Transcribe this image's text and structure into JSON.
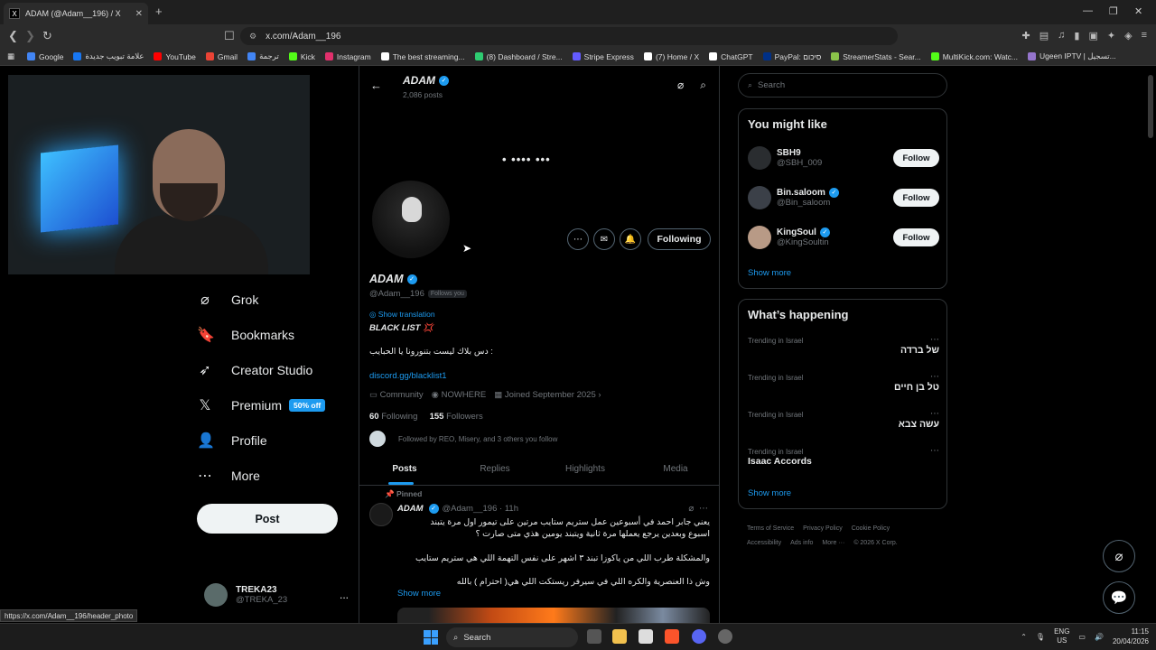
{
  "browser": {
    "tab_title": "ADAM (@Adam__196) / X",
    "new_tab": "+",
    "url": "x.com/Adam__196",
    "status_url": "https://x.com/Adam__196/header_photo",
    "bookmarks": [
      {
        "label": "Google",
        "color": "#4285f4"
      },
      {
        "label": "علامة تبويب جديدة",
        "color": "#1877f2"
      },
      {
        "label": "YouTube",
        "color": "#ff0000"
      },
      {
        "label": "Gmail",
        "color": "#ea4335"
      },
      {
        "label": "ترجمة",
        "color": "#4285f4"
      },
      {
        "label": "Kick",
        "color": "#53fc18"
      },
      {
        "label": "Instagram",
        "color": "#e1306c"
      },
      {
        "label": "The best streaming...",
        "color": "#ffffff"
      },
      {
        "label": "(8) Dashboard / Stre...",
        "color": "#2ecc71"
      },
      {
        "label": "Stripe Express",
        "color": "#635bff"
      },
      {
        "label": "(7) Home / X",
        "color": "#ffffff"
      },
      {
        "label": "ChatGPT",
        "color": "#ffffff"
      },
      {
        "label": "PayPal: סיכום",
        "color": "#003087"
      },
      {
        "label": "StreamerStats - Sear...",
        "color": "#8bc34a"
      },
      {
        "label": "MultiKick.com: Watc...",
        "color": "#53fc18"
      },
      {
        "label": "Ugeen IPTV | تسجيل...",
        "color": "#9575cd"
      }
    ]
  },
  "leftnav": {
    "items": [
      {
        "label": "Grok",
        "icon": "grok-icon",
        "glyph": "⌀"
      },
      {
        "label": "Bookmarks",
        "icon": "bookmark-icon",
        "glyph": "🔖"
      },
      {
        "label": "Creator Studio",
        "icon": "rocket-icon",
        "glyph": "➶"
      },
      {
        "label": "Premium",
        "icon": "x-logo-icon",
        "glyph": "𝕏"
      },
      {
        "label": "Profile",
        "icon": "profile-icon",
        "glyph": "👤"
      },
      {
        "label": "More",
        "icon": "more-circle-icon",
        "glyph": "⋯"
      }
    ],
    "premium_badge": "50% off",
    "post_button": "Post",
    "account": {
      "name": "TREKA23",
      "handle": "@TREKA_23",
      "menu": "..."
    }
  },
  "profile": {
    "header_name": "ADAM",
    "post_count": "2,086 posts",
    "banner_text": "• •••• •••",
    "following_button": "Following",
    "name": "ADAM",
    "handle": "@Adam__196",
    "follows_you": "Follows you",
    "show_translation": "Show translation",
    "bio_line1": "BLACK LIST 💢",
    "bio_line2": "دس بلاك ليست بتنورونا يا الحبايب :",
    "link": "discord.gg/blacklist1",
    "community": "Community",
    "location": "NOWHERE",
    "joined": "Joined September 2025",
    "following_count": "60",
    "following_label": "Following",
    "followers_count": "155",
    "followers_label": "Followers",
    "followed_by": "Followed by REO, Misery, and 3 others you follow",
    "tabs": [
      "Posts",
      "Replies",
      "Highlights",
      "Media"
    ]
  },
  "tweet": {
    "pinned": "Pinned",
    "name": "ADAM",
    "handle": "@Adam__196",
    "time": "· 11h",
    "lines": [
      "يعني جابر  احمد في أسبوعين عمل ستريم ستايب مرتين على تيمور اول مرة يتبند",
      "اسبوع وبعدين يرجع يعملها مرة ثانية ويتبند يومين هذي متى صارت ؟",
      "والمشكلة طرب اللي من ياكوزا تبند ٣ اشهر على نفس التهمة اللي هي ستريم ستايب",
      "وش ذا العنصرية والكره اللي في سيرفر ريستكت اللي هي( احترام ) بالله"
    ],
    "show_more": "Show more"
  },
  "right": {
    "search_placeholder": "Search",
    "might_like_title": "You might like",
    "suggestions": [
      {
        "name": "SBH9",
        "handle": "@SBH_009",
        "verified": false,
        "avatar_color": "#2a2d30",
        "follow": "Follow"
      },
      {
        "name": "Bin.saloom",
        "handle": "@Bin_saloom",
        "verified": true,
        "avatar_color": "#3b4048",
        "follow": "Follow"
      },
      {
        "name": "KingSoul",
        "handle": "@KingSoultin",
        "verified": true,
        "avatar_color": "#b89a86",
        "follow": "Follow"
      }
    ],
    "show_more": "Show more",
    "happening_title": "What’s happening",
    "trends": [
      {
        "context": "Trending in Israel",
        "title": "של ברדה",
        "rtl": true
      },
      {
        "context": "Trending in Israel",
        "title": "טל בן חיים",
        "rtl": true
      },
      {
        "context": "Trending in Israel",
        "title": "עשה צבא",
        "rtl": true
      },
      {
        "context": "Trending in Israel",
        "title": "Isaac Accords",
        "rtl": false
      }
    ],
    "trends_show_more": "Show more",
    "footer": [
      "Terms of Service",
      "Privacy Policy",
      "Cookie Policy",
      "Accessibility",
      "Ads info",
      "More ···",
      "© 2026 X Corp."
    ]
  },
  "taskbar": {
    "search": "Search",
    "lang_top": "ENG",
    "lang_bottom": "US",
    "time": "11:15",
    "date": "20/04/2026"
  }
}
